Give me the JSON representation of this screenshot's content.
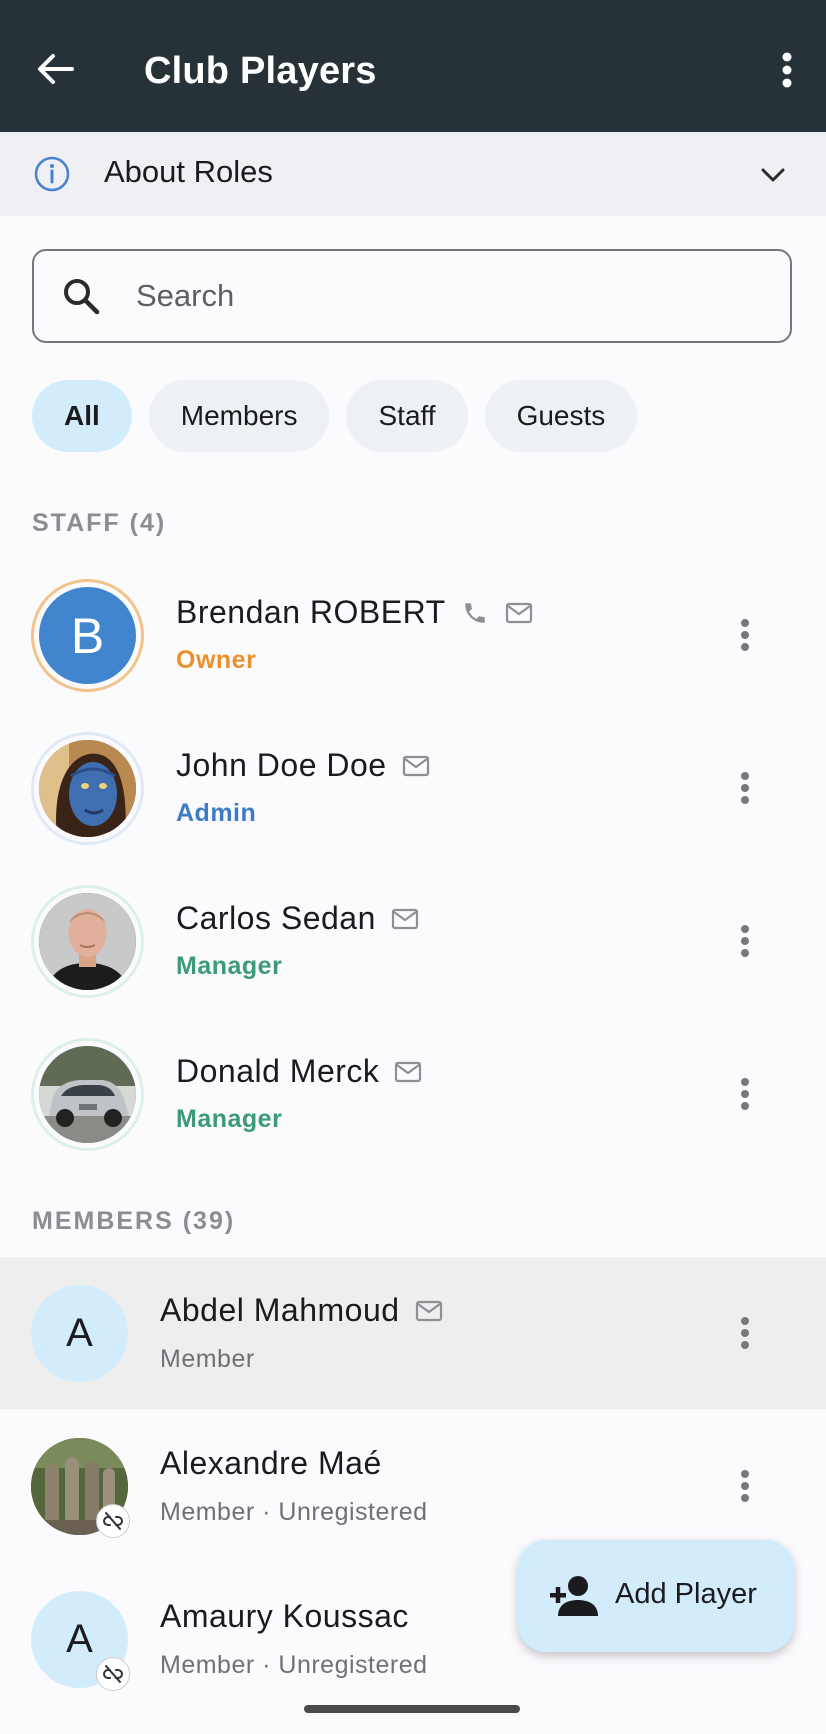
{
  "app_bar": {
    "title": "Club Players"
  },
  "about_roles": {
    "label": "About Roles"
  },
  "search": {
    "placeholder": "Search"
  },
  "filters": [
    {
      "label": "All",
      "selected": true
    },
    {
      "label": "Members",
      "selected": false
    },
    {
      "label": "Staff",
      "selected": false
    },
    {
      "label": "Guests",
      "selected": false
    }
  ],
  "sections": {
    "staff": "STAFF (4)",
    "members": "MEMBERS (39)"
  },
  "staff": [
    {
      "name": "Brendan ROBERT",
      "role": "Owner",
      "role_color": "#e8912d",
      "initial": "B",
      "has_phone": true,
      "has_email": true
    },
    {
      "name": "John Doe Doe",
      "role": "Admin",
      "role_color": "#3d7cc4",
      "has_email": true,
      "photo": "blue-face-photo"
    },
    {
      "name": "Carlos Sedan",
      "role": "Manager",
      "role_color": "#3b9a7a",
      "has_email": true,
      "photo": "portrait-photo"
    },
    {
      "name": "Donald Merck",
      "role": "Manager",
      "role_color": "#3b9a7a",
      "has_email": true,
      "photo": "car-photo"
    }
  ],
  "members": [
    {
      "name": "Abdel Mahmoud",
      "subtitle": "Member",
      "initial": "A",
      "has_email": true
    },
    {
      "name": "Alexandre Maé",
      "subtitle": "Member · Unregistered",
      "photo": "statues-photo"
    },
    {
      "name": "Amaury Koussac",
      "subtitle": "Member · Unregistered",
      "initial": "A"
    }
  ],
  "fab": {
    "label": "Add Player",
    "icon": "person-add-icon"
  },
  "colors": {
    "app_bar": "#263238",
    "chip_selected": "#d3ecfb",
    "owner": "#e8912d",
    "admin": "#3d7cc4",
    "manager": "#3b9a7a",
    "initial_avatar_bg": "#d3ecfb",
    "owner_avatar_bg": "#4285cf"
  }
}
